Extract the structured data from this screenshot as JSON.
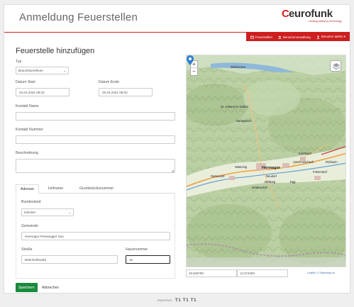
{
  "header": {
    "title": "Anmeldung Feuerstellen",
    "logo_text": "eurofunk",
    "logo_tagline": "creating safety by technology"
  },
  "navbar": {
    "items": [
      {
        "label": "Feuerstellen",
        "icon": "fire-icon"
      },
      {
        "label": "Benutzerverwaltung",
        "icon": "users-icon"
      },
      {
        "label": "Benutzer admin ▾",
        "icon": "user-icon"
      }
    ],
    "accent_color": "#cc1f1f"
  },
  "form": {
    "title": "Feuerstelle hinzufügen",
    "typ_label": "Typ",
    "typ_value": "Brauchtumsfeuer",
    "datum_start_label": "Datum Start",
    "datum_start_value": "22.04.2021 08:32",
    "datum_ende_label": "Datum Ende",
    "datum_ende_value": "26.04.2021 08:32",
    "kontakt_name_label": "Kontakt Name",
    "kontakt_name_value": "",
    "kontakt_nummer_label": "Kontakt Nummer",
    "kontakt_nummer_value": "",
    "beschreibung_label": "Beschreibung",
    "beschreibung_value": ""
  },
  "tabs": {
    "items": [
      "Adresse",
      "Hofname",
      "Grundstücksnummer"
    ],
    "active": "Adresse"
  },
  "address": {
    "bundesland_label": "Bundesland",
    "bundesland_value": "Kärnten",
    "gemeinde_label": "Gemeinde",
    "gemeinde_value": "Hermagor-Pressegger See",
    "strasse_label": "Straße",
    "strasse_value": "Bahnhofstraße",
    "hausnummer_label": "Hausnummer",
    "hausnummer_value": "15"
  },
  "buttons": {
    "save": "Speichern",
    "cancel": "Abbrechen"
  },
  "map": {
    "zoom_in": "+",
    "zoom_out": "−",
    "latitude": "46.626799",
    "longitude": "13.374306",
    "attribution": "Leaflet | © Basemap.at",
    "labels": {
      "weissensee": "Weißensee",
      "st_johann": "St. Johann im Gailtal",
      "nampolach": "Nampolach",
      "hermagor": "Hermagor",
      "untermoschach": "Untermoschach",
      "kirchbach": "Kirchbach",
      "neudorf": "Neudorf",
      "mellweg": "Mellweg",
      "moderndorf": "Möderndorf",
      "watschig": "Watschig",
      "egg": "Egg",
      "rattendorf": "Rattendorf",
      "fritzendorf": "Fritzendorf",
      "rosswein": "Roßwein"
    }
  },
  "footer": {
    "impressum": "Impressum",
    "logos": "T1 T1 T1"
  }
}
